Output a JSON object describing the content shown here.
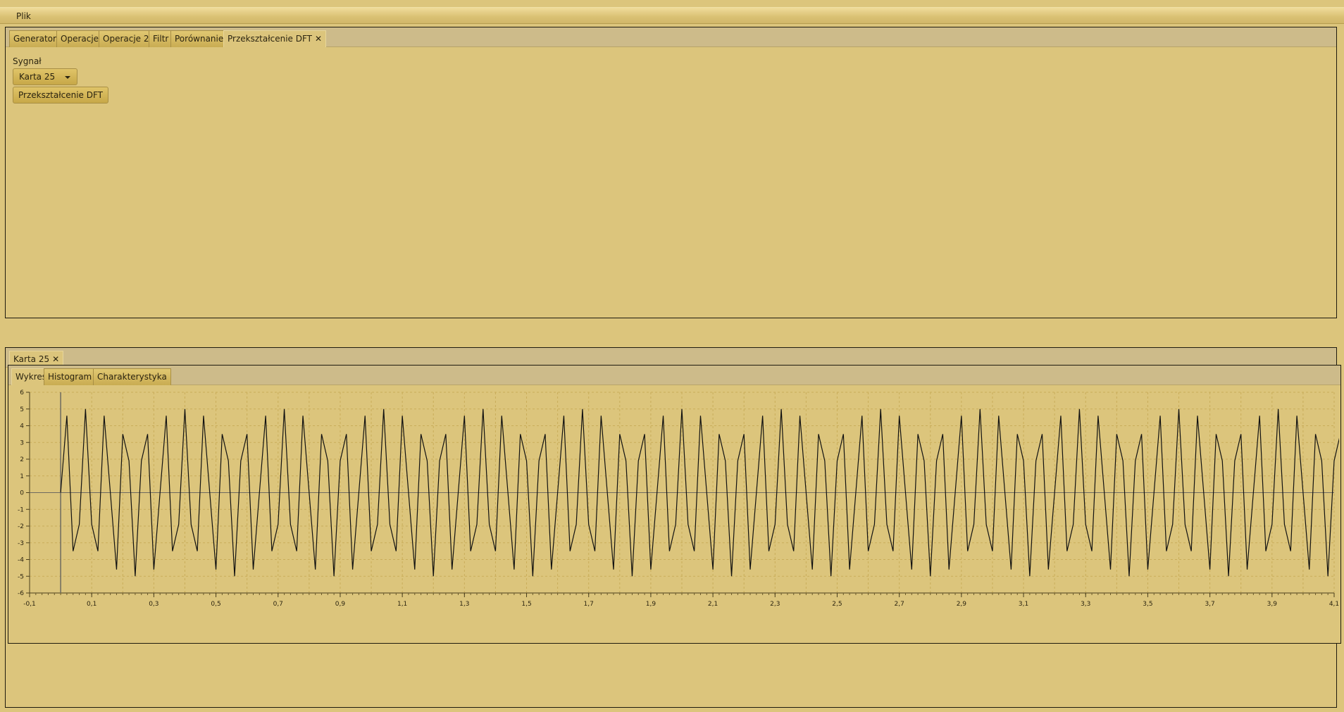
{
  "menubar": {
    "file": "Plik"
  },
  "top_pane": {
    "tabs": [
      {
        "label": "Generator"
      },
      {
        "label": "Operacje"
      },
      {
        "label": "Operacje 2"
      },
      {
        "label": "Filtr"
      },
      {
        "label": "Porównanie"
      },
      {
        "label": "Przekształcenie DFT",
        "active": true,
        "closable": true
      }
    ],
    "signal_label": "Sygnał",
    "signal_select": {
      "selected": "Karta 25"
    },
    "dft_button": "Przekształcenie DFT"
  },
  "bottom_pane": {
    "tabs": [
      {
        "label": "Karta 25",
        "active": true,
        "closable": true
      }
    ],
    "sub_tabs": [
      {
        "label": "Wykres",
        "active": true
      },
      {
        "label": "Histogram"
      },
      {
        "label": "Charakterystyka"
      }
    ]
  },
  "colors": {
    "background": "#dcc57c",
    "line": "#111111",
    "grid": "#c9ad5a"
  },
  "chart_data": {
    "type": "line",
    "title": "",
    "xlabel": "",
    "ylabel": "",
    "xlim": [
      -0.1,
      4.1
    ],
    "ylim": [
      -6,
      6
    ],
    "x_ticks": [
      "-0,1",
      "0,1",
      "0,3",
      "0,5",
      "0,7",
      "0,9",
      "1,1",
      "1,3",
      "1,5",
      "1,7",
      "1,9",
      "2,1",
      "2,3",
      "2,5",
      "2,7",
      "2,9",
      "3,1",
      "3,3",
      "3,5",
      "3,7",
      "3,9",
      "4,1"
    ],
    "y_ticks": [
      "6",
      "5",
      "4",
      "3",
      "2",
      "1",
      "0",
      "-1",
      "-2",
      "-3",
      "-4",
      "-5",
      "-6"
    ],
    "grid": true,
    "legend": "none",
    "series": [
      {
        "x_start": 0,
        "x_step": 0.02,
        "values": [
          0,
          4.6,
          -3.5,
          -1.9,
          5,
          -1.9,
          -3.5,
          4.6,
          0,
          -4.6,
          3.5,
          1.9,
          -5,
          1.9,
          3.5,
          -4.6,
          0,
          4.6,
          -3.5,
          -1.9,
          5,
          -1.9,
          -3.5,
          4.6,
          0,
          -4.6,
          3.5,
          1.9,
          -5,
          1.9,
          3.5,
          -4.6,
          0,
          4.6,
          -3.5,
          -1.9,
          5,
          -1.9,
          -3.5,
          4.6,
          0,
          -4.6,
          3.5,
          1.9,
          -5,
          1.9,
          3.5,
          -4.6,
          0,
          4.6,
          -3.5,
          -1.9,
          5,
          -1.9,
          -3.5,
          4.6,
          0,
          -4.6,
          3.5,
          1.9,
          -5,
          1.9,
          3.5,
          -4.6,
          0,
          4.6,
          -3.5,
          -1.9,
          5,
          -1.9,
          -3.5,
          4.6,
          0,
          -4.6,
          3.5,
          1.9,
          -5,
          1.9,
          3.5,
          -4.6,
          0,
          4.6,
          -3.5,
          -1.9,
          5,
          -1.9,
          -3.5,
          4.6,
          0,
          -4.6,
          3.5,
          1.9,
          -5,
          1.9,
          3.5,
          -4.6,
          0,
          4.6,
          -3.5,
          -1.9,
          5,
          -1.9,
          -3.5,
          4.6,
          0,
          -4.6,
          3.5,
          1.9,
          -5,
          1.9,
          3.5,
          -4.6,
          0,
          4.6,
          -3.5,
          -1.9,
          5,
          -1.9,
          -3.5,
          4.6,
          0,
          -4.6,
          3.5,
          1.9,
          -5,
          1.9,
          3.5,
          -4.6,
          0,
          4.6,
          -3.5,
          -1.9,
          5,
          -1.9,
          -3.5,
          4.6,
          0,
          -4.6,
          3.5,
          1.9,
          -5,
          1.9,
          3.5,
          -4.6,
          0,
          4.6,
          -3.5,
          -1.9,
          5,
          -1.9,
          -3.5,
          4.6,
          0,
          -4.6,
          3.5,
          1.9,
          -5,
          1.9,
          3.5,
          -4.6,
          0,
          4.6,
          -3.5,
          -1.9,
          5,
          -1.9,
          -3.5,
          4.6,
          0,
          -4.6,
          3.5,
          1.9,
          -5,
          1.9,
          3.5,
          -4.6,
          0,
          4.6,
          -3.5,
          -1.9,
          5,
          -1.9,
          -3.5,
          4.6,
          0,
          -4.6,
          3.5,
          1.9,
          -5,
          1.9,
          3.5,
          -4.6,
          0,
          4.6,
          -3.5,
          -1.9,
          5,
          -1.9,
          -3.5,
          4.6,
          0,
          -4.6,
          3.5,
          1.9,
          -5,
          1.9,
          3.5,
          -4.6,
          0
        ]
      }
    ]
  }
}
